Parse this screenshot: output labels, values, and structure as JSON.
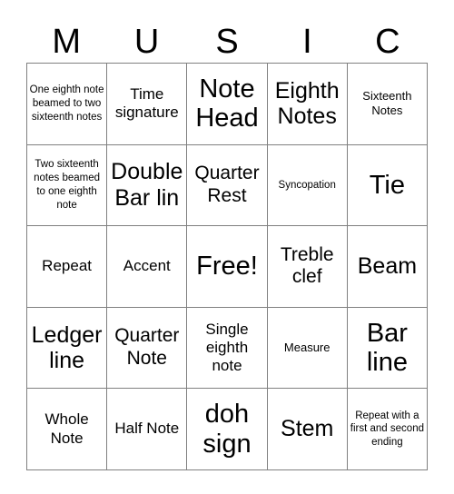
{
  "card": {
    "title": "MUSIC",
    "header_letters": [
      "M",
      "U",
      "S",
      "I",
      "C"
    ],
    "grid_size": "5x5",
    "border_color": "#808080",
    "text_color": "#000000",
    "background_color": "#ffffff",
    "rows": [
      [
        {
          "text": "One eighth note beamed to two sixteenth notes",
          "size": "xs"
        },
        {
          "text": "Time signature",
          "size": "md"
        },
        {
          "text": "Note Head",
          "size": "xxl"
        },
        {
          "text": "Eighth Notes",
          "size": "xl"
        },
        {
          "text": "Sixteenth Notes",
          "size": "sm"
        }
      ],
      [
        {
          "text": "Two sixteenth notes beamed to one eighth note",
          "size": "xs"
        },
        {
          "text": "Double Bar lin",
          "size": "xl"
        },
        {
          "text": "Quarter Rest",
          "size": "lg"
        },
        {
          "text": "Syncopation",
          "size": "xs"
        },
        {
          "text": "Tie",
          "size": "xxl"
        }
      ],
      [
        {
          "text": "Repeat",
          "size": "md"
        },
        {
          "text": "Accent",
          "size": "md"
        },
        {
          "text": "Free!",
          "size": "xxl"
        },
        {
          "text": "Treble clef",
          "size": "lg"
        },
        {
          "text": "Beam",
          "size": "xl"
        }
      ],
      [
        {
          "text": "Ledger line",
          "size": "xl"
        },
        {
          "text": "Quarter Note",
          "size": "lg"
        },
        {
          "text": "Single eighth note",
          "size": "md"
        },
        {
          "text": "Measure",
          "size": "sm"
        },
        {
          "text": "Bar line",
          "size": "xxl"
        }
      ],
      [
        {
          "text": "Whole Note",
          "size": "md"
        },
        {
          "text": "Half Note",
          "size": "md"
        },
        {
          "text": "doh sign",
          "size": "xxl"
        },
        {
          "text": "Stem",
          "size": "xl"
        },
        {
          "text": "Repeat with a first and second ending",
          "size": "xs"
        }
      ]
    ]
  }
}
